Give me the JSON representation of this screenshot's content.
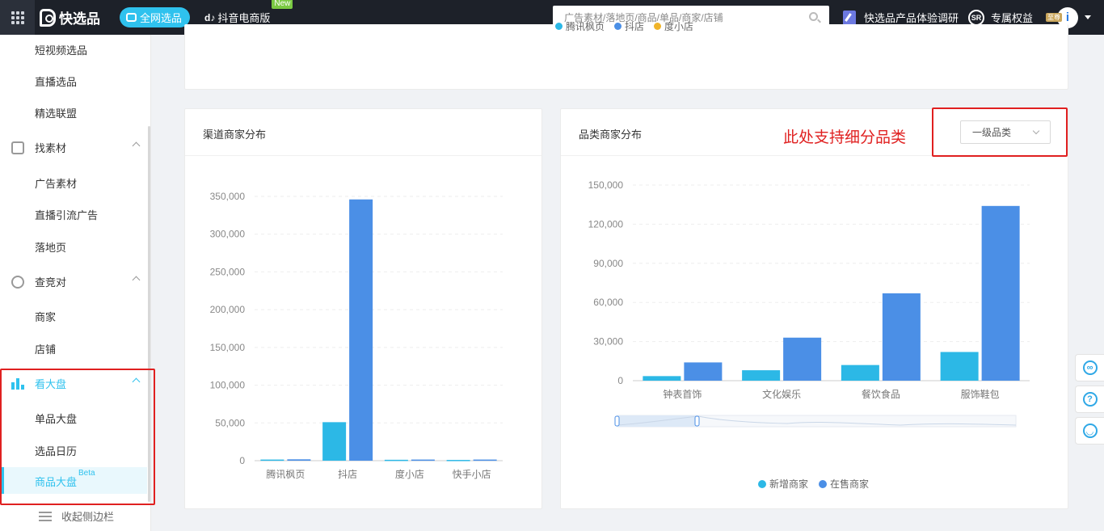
{
  "topbar": {
    "logo_text": "快选品",
    "pill_label": "全网选品",
    "douyin_label": "抖音电商版",
    "new_badge": "New",
    "search_placeholder": "广告素材/落地页/商品/单品/商家/店铺",
    "survey_label": "快选品产品体验调研",
    "sr_label": "SR",
    "benefit_label": "专属权益",
    "vip_badge": "至尊"
  },
  "sidebar": {
    "items_top": [
      "短视频选品",
      "直播选品",
      "精选联盟"
    ],
    "group_material": "找素材",
    "items_material": [
      "广告素材",
      "直播引流广告",
      "落地页"
    ],
    "group_compete": "查竞对",
    "items_compete": [
      "商家",
      "店铺"
    ],
    "group_dashboard": "看大盘",
    "items_dashboard": [
      "单品大盘",
      "选品日历",
      "商品大盘"
    ],
    "beta": "Beta",
    "collapse_label": "收起侧边栏"
  },
  "top_card": {
    "legend": [
      "腾讯枫页",
      "抖店",
      "度小店"
    ]
  },
  "channel_card": {
    "title": "渠道商家分布"
  },
  "category_card": {
    "title": "品类商家分布",
    "annotation": "此处支持细分品类",
    "select_value": "一级品类"
  },
  "colors": {
    "accent": "#2fc2ee",
    "new_merchant": "#2cb8e6",
    "on_sale_merchant": "#4b8fe6",
    "annotation_red": "#e02020"
  },
  "chart_data": [
    {
      "type": "bar",
      "title": "渠道商家分布",
      "categories": [
        "腾讯枫页",
        "抖店",
        "度小店",
        "快手小店"
      ],
      "series": [
        {
          "name": "新增商家",
          "values": [
            1500,
            51000,
            1200,
            1000
          ]
        },
        {
          "name": "在售商家",
          "values": [
            1800,
            346000,
            1500,
            1500
          ]
        }
      ],
      "yticks": [
        "0",
        "50,000",
        "100,000",
        "150,000",
        "200,000",
        "250,000",
        "300,000",
        "350,000"
      ],
      "ylim": [
        0,
        350000
      ],
      "legend": "bottom-center",
      "grid": true
    },
    {
      "type": "bar",
      "title": "品类商家分布",
      "categories": [
        "钟表首饰",
        "文化娱乐",
        "餐饮食品",
        "服饰鞋包"
      ],
      "series": [
        {
          "name": "新增商家",
          "values": [
            3500,
            8000,
            12000,
            22000
          ]
        },
        {
          "name": "在售商家",
          "values": [
            14000,
            33000,
            67000,
            134000
          ]
        }
      ],
      "yticks": [
        "0",
        "30,000",
        "60,000",
        "90,000",
        "120,000",
        "150,000"
      ],
      "ylim": [
        0,
        150000
      ],
      "legend": "bottom-center",
      "grid": true
    }
  ]
}
